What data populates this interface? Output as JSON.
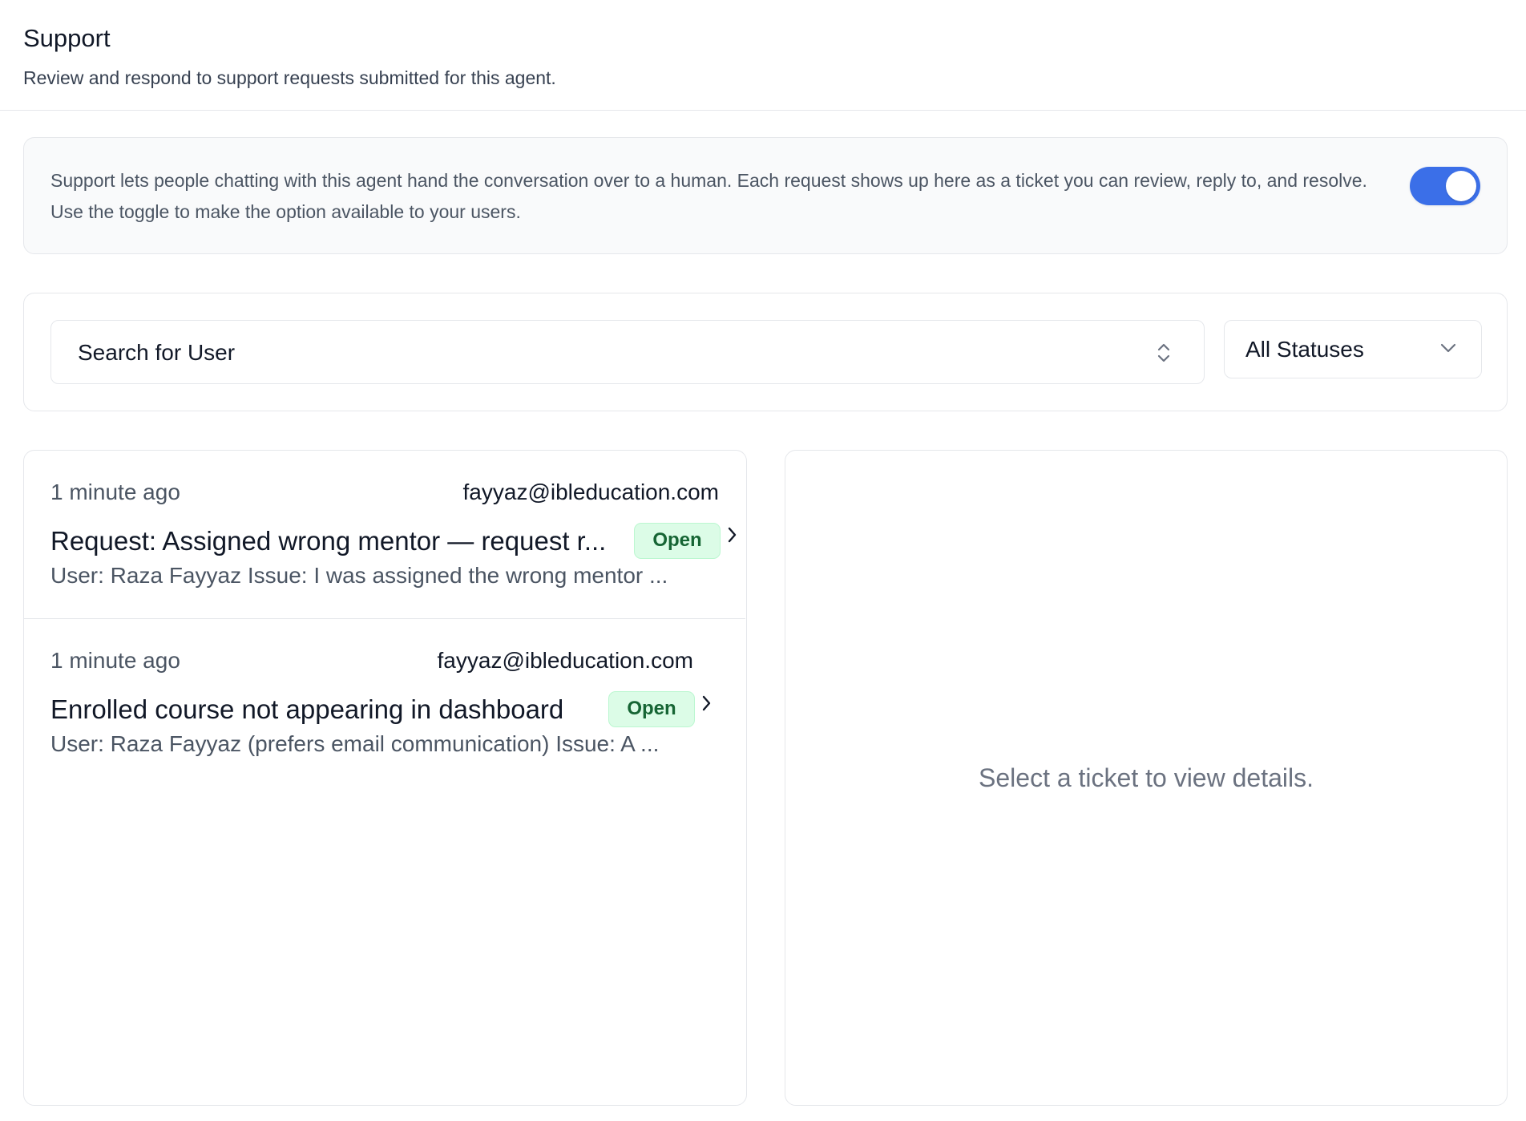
{
  "header": {
    "title": "Support",
    "subtitle": "Review and respond to support requests submitted for this agent."
  },
  "info": {
    "text": "Support lets people chatting with this agent hand the conversation over to a human. Each request shows up here as a ticket you can review, reply to, and resolve. Use the toggle to make the option available to your users.",
    "toggle_enabled": true,
    "toggle_color": "#3b6fe8"
  },
  "filters": {
    "search_placeholder": "Search for User",
    "status_selected": "All Statuses"
  },
  "tickets": [
    {
      "time": "1 minute ago",
      "email": "fayyaz@ibleducation.com",
      "title": "Request: Assigned wrong mentor — request r...",
      "status": "Open",
      "description": "User: Raza Fayyaz Issue: I was assigned the wrong mentor ..."
    },
    {
      "time": "1 minute ago",
      "email": "fayyaz@ibleducation.com",
      "title": "Enrolled course not appearing in dashboard",
      "status": "Open",
      "description": "User: Raza Fayyaz (prefers email communication) Issue: A ..."
    }
  ],
  "detail": {
    "empty_message": "Select a ticket to view details."
  },
  "colors": {
    "status_open_bg": "#dcfce7",
    "status_open_text": "#166534"
  }
}
